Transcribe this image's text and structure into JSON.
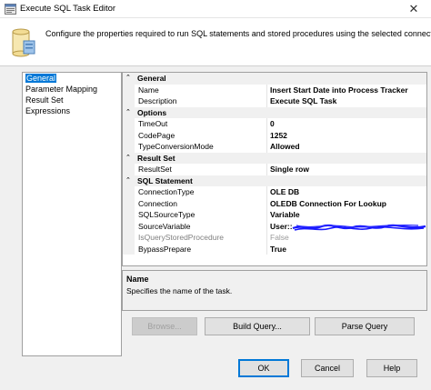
{
  "window": {
    "title": "Execute SQL Task Editor"
  },
  "header": {
    "text": "Configure the properties required to run SQL statements and stored procedures using the selected connection."
  },
  "nav": {
    "items": [
      {
        "label": "General",
        "selected": true
      },
      {
        "label": "Parameter Mapping"
      },
      {
        "label": "Result Set"
      },
      {
        "label": "Expressions"
      }
    ]
  },
  "grid": {
    "general": {
      "label": "General",
      "name": {
        "name": "Name",
        "value": "Insert Start Date into Process Tracker"
      },
      "description": {
        "name": "Description",
        "value": "Execute SQL Task"
      }
    },
    "options": {
      "label": "Options",
      "timeout": {
        "name": "TimeOut",
        "value": "0"
      },
      "codepage": {
        "name": "CodePage",
        "value": "1252"
      },
      "typeconv": {
        "name": "TypeConversionMode",
        "value": "Allowed"
      }
    },
    "resultset": {
      "label": "Result Set",
      "resultset": {
        "name": "ResultSet",
        "value": "Single row"
      }
    },
    "sqlstatement": {
      "label": "SQL Statement",
      "connectiontype": {
        "name": "ConnectionType",
        "value": "OLE DB"
      },
      "connection": {
        "name": "Connection",
        "value": "OLEDB Connection For Lookup"
      },
      "sqlsourcetype": {
        "name": "SQLSourceType",
        "value": "Variable"
      },
      "sourcevariable": {
        "name": "SourceVariable",
        "value": "User::"
      },
      "isquerystored": {
        "name": "IsQueryStoredProcedure",
        "value": "False"
      },
      "bypassprepare": {
        "name": "BypassPrepare",
        "value": "True"
      }
    }
  },
  "description_panel": {
    "title": "Name",
    "text": "Specifies the name of the task."
  },
  "buttons": {
    "browse": "Browse...",
    "build_query": "Build Query...",
    "parse_query": "Parse Query",
    "ok": "OK",
    "cancel": "Cancel",
    "help": "Help"
  },
  "icons": {
    "title": "sql-task-icon",
    "header": "wizard-scroll-icon",
    "close": "close-icon",
    "collapse": "chevron-collapse-icon"
  },
  "colors": {
    "selection": "#0078d7",
    "redaction": "#1a1aff"
  }
}
